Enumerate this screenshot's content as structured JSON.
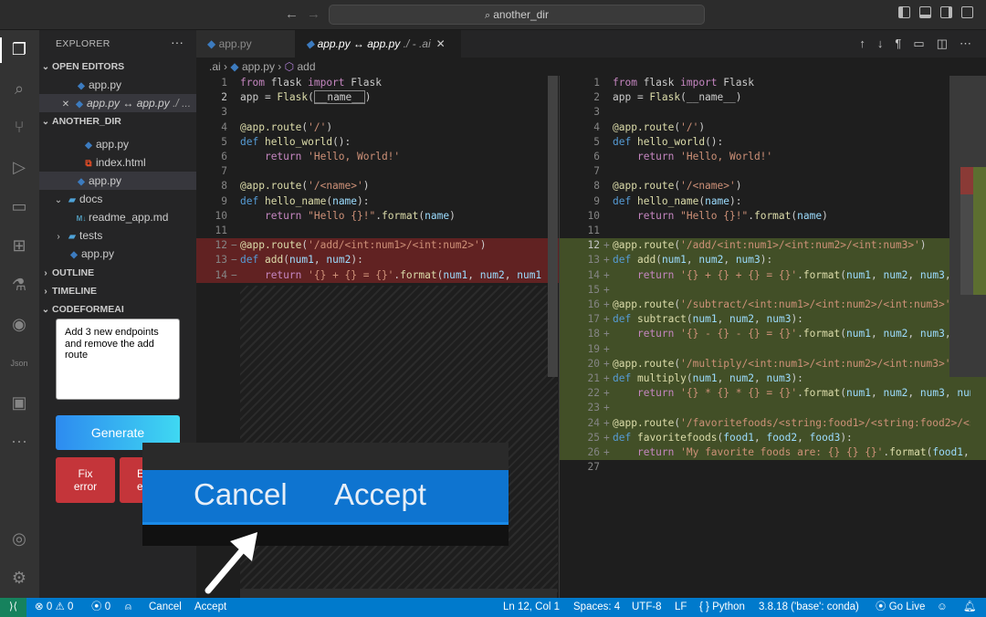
{
  "titlebar": {
    "search_text": "another_dir",
    "back_icon": "arrow-left-icon",
    "forward_icon": "arrow-right-icon"
  },
  "sidebar": {
    "title": "EXPLORER",
    "open_editors_header": "OPEN EDITORS",
    "open_editors": [
      {
        "name": "app.py"
      },
      {
        "name": "app.py ↔ app.py",
        "path": "./ ..."
      }
    ],
    "project_header": "ANOTHER_DIR",
    "files": [
      {
        "name": "app.py"
      },
      {
        "name": "index.html"
      },
      {
        "name": "app.py"
      },
      {
        "name": "docs"
      },
      {
        "name": "readme_app.md"
      },
      {
        "name": "tests"
      },
      {
        "name": "app.py"
      }
    ],
    "outline_header": "OUTLINE",
    "timeline_header": "TIMELINE",
    "codeformeai_header": "CODEFORMEAI",
    "prompt_text": "Add 3 new endpoints and remove the add route",
    "generate_label": "Generate",
    "fix_label_1": "Fix",
    "fix_label_2": "error",
    "explain_label_1": "E",
    "explain_label_2": "e"
  },
  "tabs": [
    {
      "label": "app.py"
    },
    {
      "label": "app.py ↔ app.py",
      "path": "./ - .ai"
    }
  ],
  "breadcrumb": {
    "folder": ".ai",
    "file": "app.py",
    "symbol": "add"
  },
  "overlay": {
    "cancel_label": "Cancel",
    "accept_label": "Accept"
  },
  "statusbar": {
    "errors": "0",
    "warnings": "0",
    "ports": "0",
    "cancel": "Cancel",
    "accept": "Accept",
    "position": "Ln 12, Col 1",
    "spaces": "Spaces: 4",
    "encoding": "UTF-8",
    "eol": "LF",
    "language": "Python",
    "interpreter": "3.8.18 ('base': conda)",
    "golive": "Go Live"
  },
  "colors": {
    "accent": "#007acc",
    "deleted_bg": "#8a2a2a",
    "inserted_bg": "#5e7030",
    "generate_start": "#2d8bf0",
    "generate_end": "#3fd8f2",
    "error_button": "#c4353a"
  }
}
